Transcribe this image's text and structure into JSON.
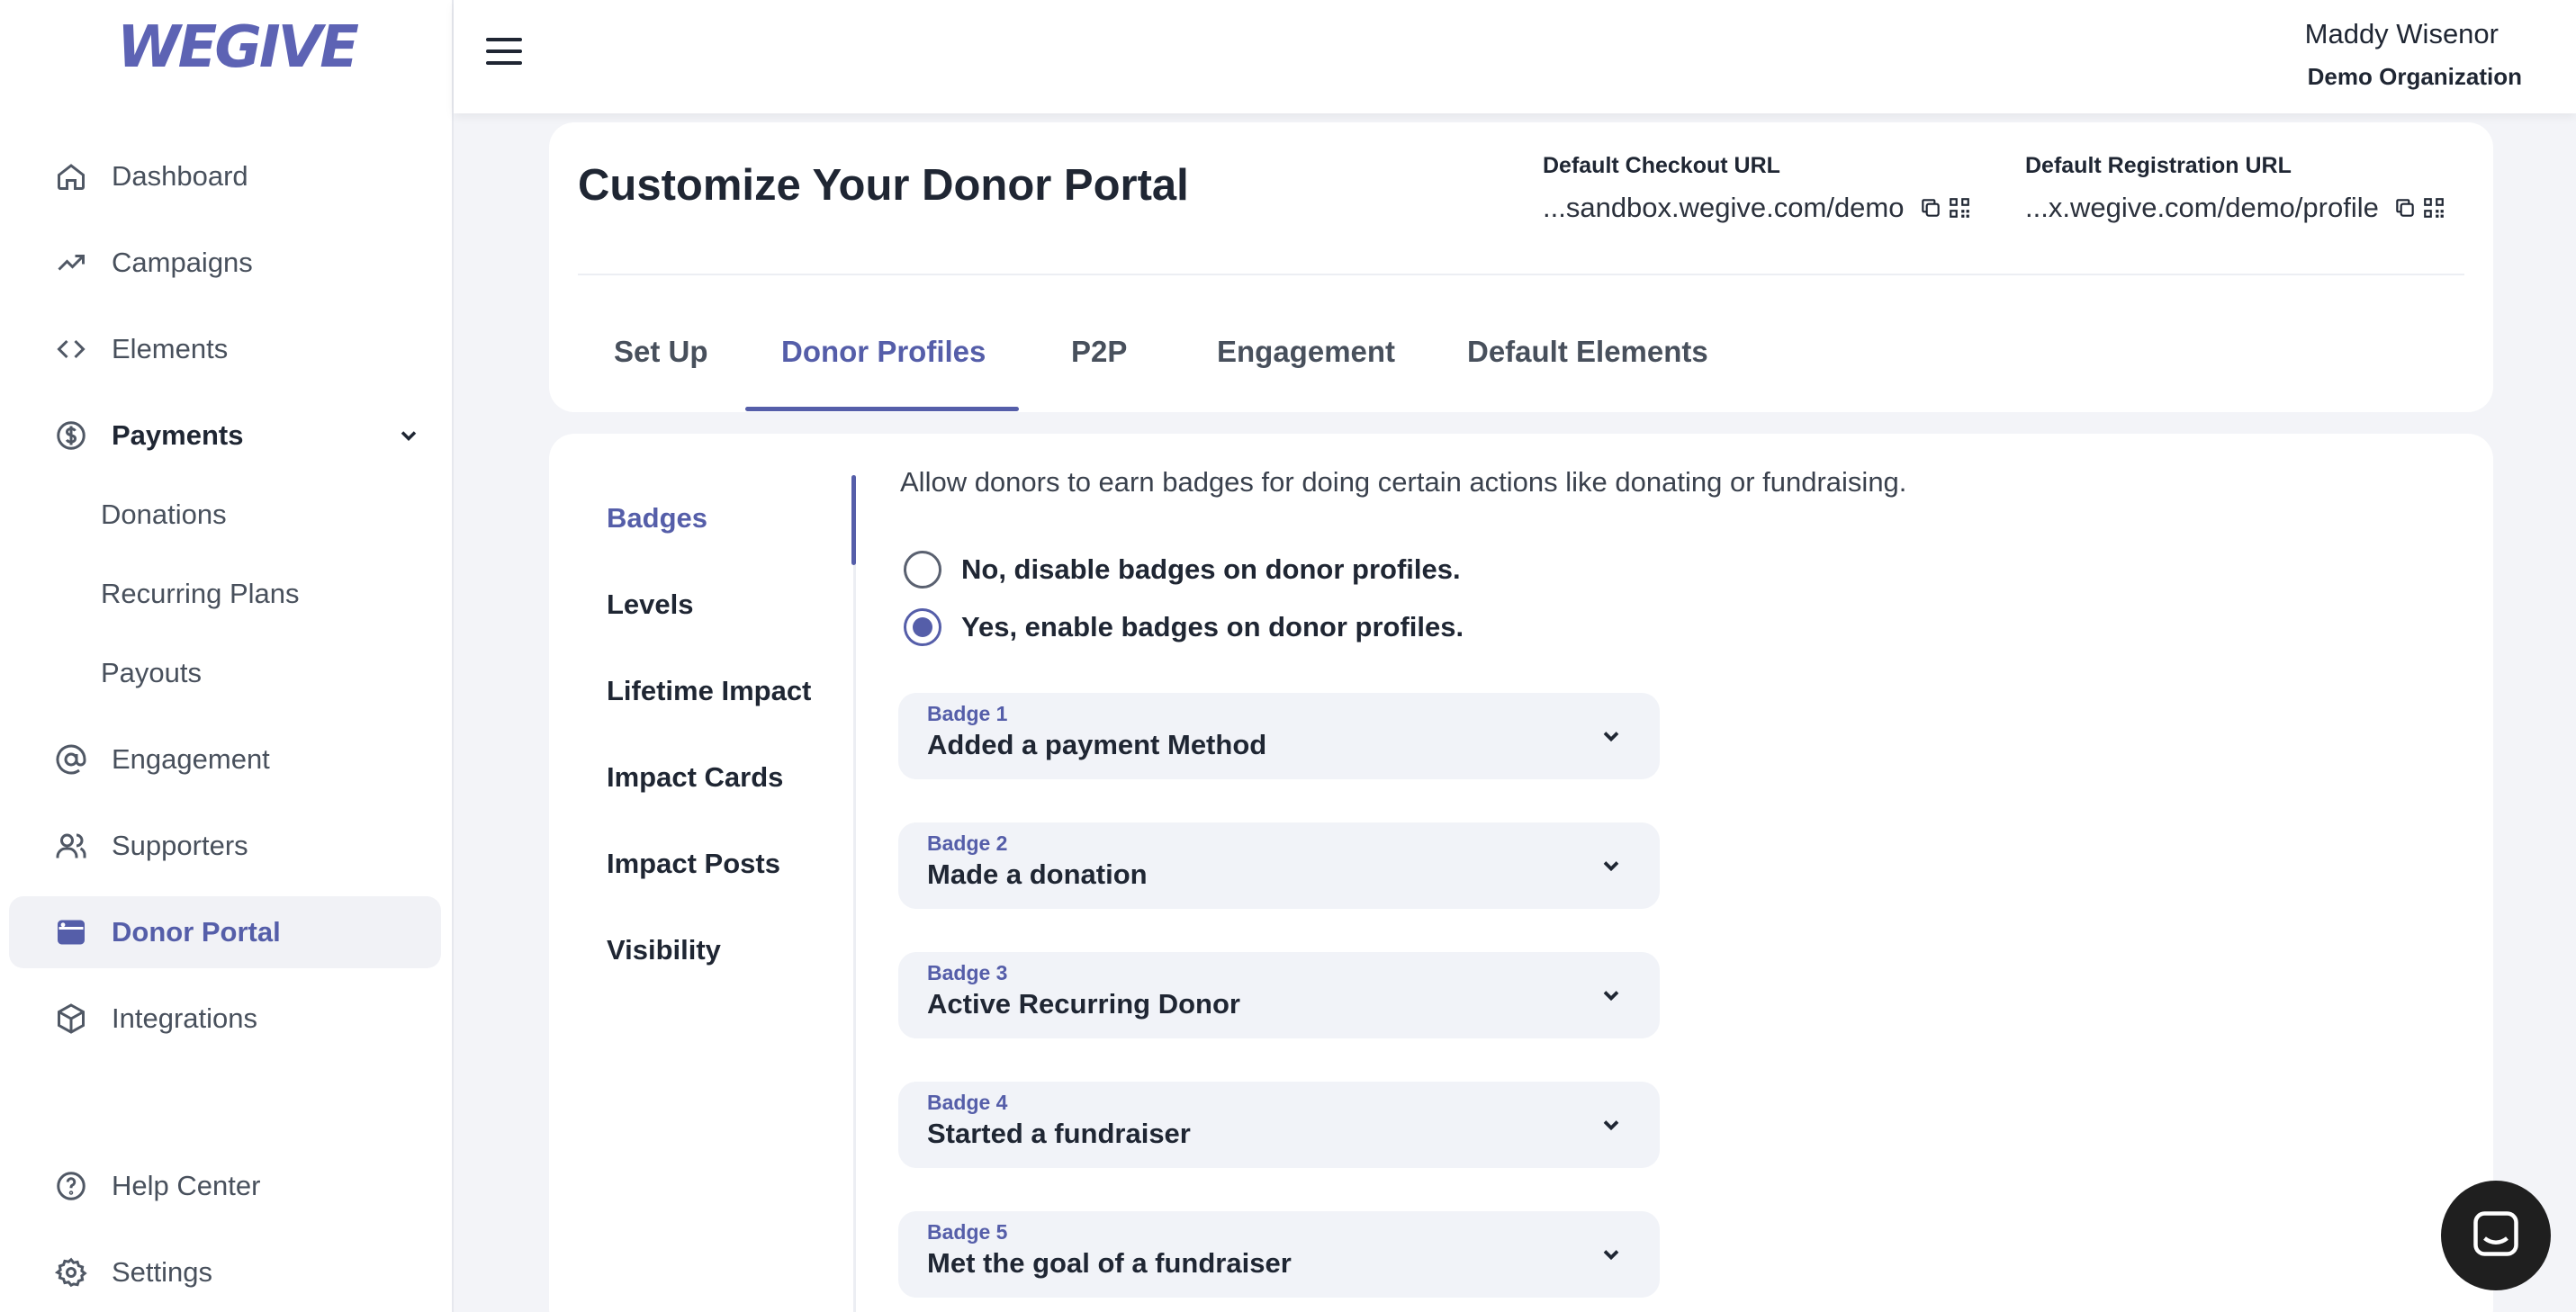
{
  "brand": {
    "logo_text": "WEGIVE",
    "accent": "#555ea9"
  },
  "sidebar": {
    "items": [
      {
        "label": "Dashboard",
        "icon": "home-icon"
      },
      {
        "label": "Campaigns",
        "icon": "trending-up-icon"
      },
      {
        "label": "Elements",
        "icon": "code-icon"
      },
      {
        "label": "Payments",
        "icon": "dollar-circle-icon",
        "expanded": true
      },
      {
        "label": "Engagement",
        "icon": "at-sign-icon"
      },
      {
        "label": "Supporters",
        "icon": "users-icon"
      },
      {
        "label": "Donor Portal",
        "icon": "browser-window-icon",
        "active": true
      },
      {
        "label": "Integrations",
        "icon": "cube-icon"
      },
      {
        "label": "Help Center",
        "icon": "help-circle-icon"
      },
      {
        "label": "Settings",
        "icon": "gear-icon"
      }
    ],
    "payments_sub": [
      "Donations",
      "Recurring Plans",
      "Payouts"
    ]
  },
  "header": {
    "user_name": "Maddy Wisenor",
    "organization": "Demo Organization"
  },
  "portal": {
    "title": "Customize Your Donor Portal",
    "checkout_url": {
      "label": "Default Checkout URL",
      "value": "...sandbox.wegive.com/demo"
    },
    "registration_url": {
      "label": "Default Registration URL",
      "value": "...x.wegive.com/demo/profile"
    },
    "tabs": [
      {
        "label": "Set Up"
      },
      {
        "label": "Donor Profiles",
        "active": true
      },
      {
        "label": "P2P"
      },
      {
        "label": "Engagement"
      },
      {
        "label": "Default Elements"
      }
    ]
  },
  "profiles": {
    "subnav": [
      {
        "label": "Badges",
        "active": true
      },
      {
        "label": "Levels"
      },
      {
        "label": "Lifetime Impact"
      },
      {
        "label": "Impact Cards"
      },
      {
        "label": "Impact Posts"
      },
      {
        "label": "Visibility"
      }
    ],
    "description": "Allow donors to earn badges for doing certain actions like donating or fundraising.",
    "options": [
      {
        "label": "No, disable badges on donor profiles.",
        "checked": false
      },
      {
        "label": "Yes, enable badges on donor profiles.",
        "checked": true
      }
    ],
    "badges": [
      {
        "number": "Badge 1",
        "title": "Added a payment Method"
      },
      {
        "number": "Badge 2",
        "title": "Made a donation"
      },
      {
        "number": "Badge 3",
        "title": "Active Recurring Donor"
      },
      {
        "number": "Badge 4",
        "title": "Started a fundraiser"
      },
      {
        "number": "Badge 5",
        "title": "Met the goal of a fundraiser"
      }
    ]
  }
}
